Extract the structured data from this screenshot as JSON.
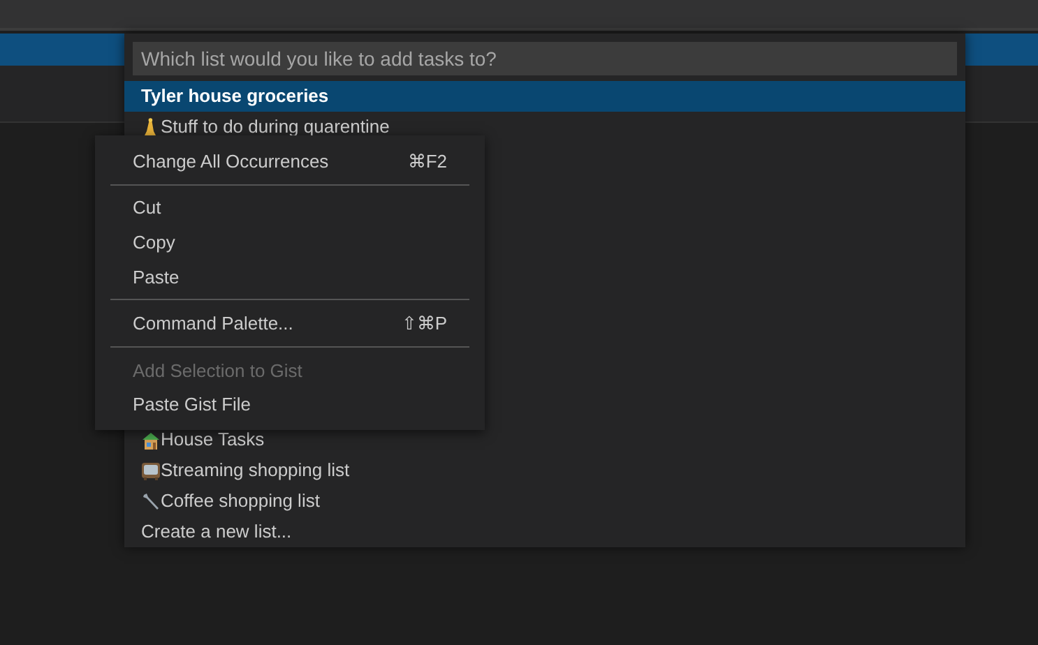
{
  "quick_pick": {
    "placeholder": "Which list would you like to add tasks to?",
    "items": [
      {
        "label": "Tyler house groceries",
        "kind": "plain",
        "selected": true
      },
      {
        "label": "Stuff to do during quarentine",
        "kind": "figure",
        "selected": false
      },
      {
        "label": "House Tasks",
        "kind": "house",
        "selected": false
      },
      {
        "label": "Streaming shopping list",
        "kind": "tv",
        "selected": false
      },
      {
        "label": "Coffee shopping list",
        "kind": "wrench",
        "selected": false
      },
      {
        "label": "Create a new list...",
        "kind": "plain",
        "selected": false
      }
    ]
  },
  "context_menu": {
    "groups": [
      [
        {
          "label": "Change All Occurrences",
          "shortcut": "⌘F2",
          "disabled": false
        }
      ],
      [
        {
          "label": "Cut",
          "disabled": false
        },
        {
          "label": "Copy",
          "disabled": false
        },
        {
          "label": "Paste",
          "disabled": false
        }
      ],
      [
        {
          "label": "Command Palette...",
          "shortcut": "⇧⌘P",
          "disabled": false
        }
      ],
      [
        {
          "label": "Add Selection to Gist",
          "disabled": true
        },
        {
          "label": "Paste Gist File",
          "disabled": false
        }
      ]
    ]
  }
}
